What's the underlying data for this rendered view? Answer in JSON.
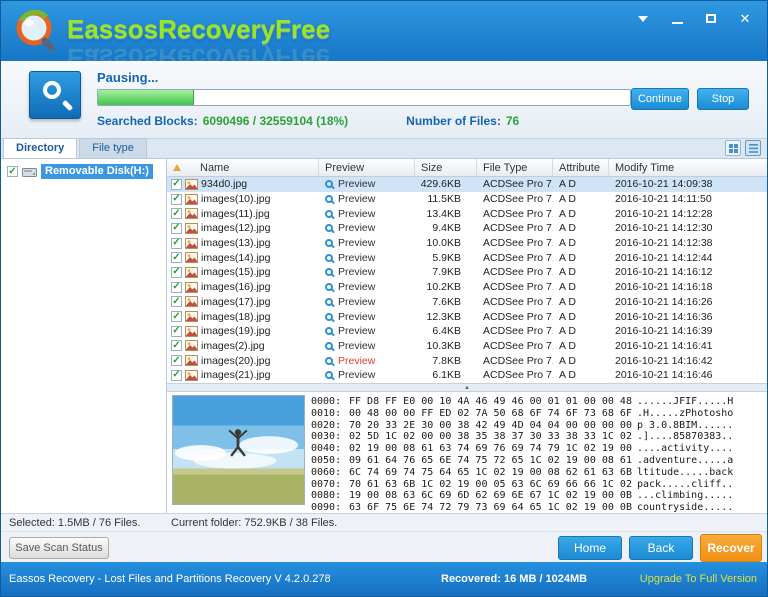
{
  "window": {
    "app_name": "Eassos Recovery Free"
  },
  "titlebar": {
    "brand_words": [
      "Eassos",
      "Recovery",
      "Free"
    ]
  },
  "progress": {
    "status": "Pausing...",
    "percent": 18,
    "continue_label": "Continue",
    "stop_label": "Stop",
    "searched_label": "Searched Blocks:",
    "searched_value": "6090496 / 32559104 (18%)",
    "files_label": "Number of Files:",
    "files_value": "76"
  },
  "tabs": [
    {
      "label": "Directory",
      "active": true
    },
    {
      "label": "File type",
      "active": false
    }
  ],
  "tree": {
    "items": [
      {
        "label": "Removable Disk(H:)",
        "checked": true,
        "selected": true
      }
    ]
  },
  "table": {
    "columns": [
      "Name",
      "Preview",
      "Size",
      "File Type",
      "Attribute",
      "Modify Time"
    ],
    "preview_label": "Preview",
    "rows": [
      {
        "name": "934d0.jpg",
        "size": "429.6KB",
        "type": "ACDSee Pro 7...",
        "attr": "A D",
        "modify_time": "2016-10-21 14:09:38",
        "checked": true,
        "selected": true
      },
      {
        "name": "images(10).jpg",
        "size": "11.5KB",
        "type": "ACDSee Pro 7...",
        "attr": "A D",
        "modify_time": "2016-10-21 14:11:50",
        "checked": true
      },
      {
        "name": "images(11).jpg",
        "size": "13.4KB",
        "type": "ACDSee Pro 7...",
        "attr": "A D",
        "modify_time": "2016-10-21 14:12:28",
        "checked": true
      },
      {
        "name": "images(12).jpg",
        "size": "9.4KB",
        "type": "ACDSee Pro 7...",
        "attr": "A D",
        "modify_time": "2016-10-21 14:12:30",
        "checked": true
      },
      {
        "name": "images(13).jpg",
        "size": "10.0KB",
        "type": "ACDSee Pro 7...",
        "attr": "A D",
        "modify_time": "2016-10-21 14:12:38",
        "checked": true
      },
      {
        "name": "images(14).jpg",
        "size": "5.9KB",
        "type": "ACDSee Pro 7...",
        "attr": "A D",
        "modify_time": "2016-10-21 14:12:44",
        "checked": true
      },
      {
        "name": "images(15).jpg",
        "size": "7.9KB",
        "type": "ACDSee Pro 7...",
        "attr": "A D",
        "modify_time": "2016-10-21 14:16:12",
        "checked": true
      },
      {
        "name": "images(16).jpg",
        "size": "10.2KB",
        "type": "ACDSee Pro 7...",
        "attr": "A D",
        "modify_time": "2016-10-21 14:16:18",
        "checked": true
      },
      {
        "name": "images(17).jpg",
        "size": "7.6KB",
        "type": "ACDSee Pro 7...",
        "attr": "A D",
        "modify_time": "2016-10-21 14:16:26",
        "checked": true
      },
      {
        "name": "images(18).jpg",
        "size": "12.3KB",
        "type": "ACDSee Pro 7...",
        "attr": "A D",
        "modify_time": "2016-10-21 14:16:36",
        "checked": true
      },
      {
        "name": "images(19).jpg",
        "size": "6.4KB",
        "type": "ACDSee Pro 7...",
        "attr": "A D",
        "modify_time": "2016-10-21 14:16:39",
        "checked": true
      },
      {
        "name": "images(2).jpg",
        "size": "10.3KB",
        "type": "ACDSee Pro 7...",
        "attr": "A D",
        "modify_time": "2016-10-21 14:16:41",
        "checked": true
      },
      {
        "name": "images(20).jpg",
        "size": "7.8KB",
        "type": "ACDSee Pro 7...",
        "attr": "A D",
        "modify_time": "2016-10-21 14:16:42",
        "checked": true,
        "preview_red": true
      },
      {
        "name": "images(21).jpg",
        "size": "6.1KB",
        "type": "ACDSee Pro 7...",
        "attr": "A D",
        "modify_time": "2016-10-21 14:16:46",
        "checked": true
      }
    ]
  },
  "preview": {
    "hex_rows": [
      {
        "offset": "0000:",
        "hex": "FF D8 FF E0 00 10 4A 46 49 46 00 01 01 00 00 48",
        "ascii": "......JFIF.....H"
      },
      {
        "offset": "0010:",
        "hex": "00 48 00 00 FF ED 02 7A 50 68 6F 74 6F 73 68 6F",
        "ascii": ".H.....zPhotosho"
      },
      {
        "offset": "0020:",
        "hex": "70 20 33 2E 30 00 38 42 49 4D 04 04 00 00 00 00",
        "ascii": "p 3.0.8BIM......"
      },
      {
        "offset": "0030:",
        "hex": "02 5D 1C 02 00 00 38 35 38 37 30 33 38 33 1C 02",
        "ascii": ".]....85870383.."
      },
      {
        "offset": "0040:",
        "hex": "02 19 00 08 61 63 74 69 76 69 74 79 1C 02 19 00",
        "ascii": "....activity...."
      },
      {
        "offset": "0050:",
        "hex": "09 61 64 76 65 6E 74 75 72 65 1C 02 19 00 08 61",
        "ascii": ".adventure.....a"
      },
      {
        "offset": "0060:",
        "hex": "6C 74 69 74 75 64 65 1C 02 19 00 08 62 61 63 6B",
        "ascii": "ltitude.....back"
      },
      {
        "offset": "0070:",
        "hex": "70 61 63 6B 1C 02 19 00 05 63 6C 69 66 66 1C 02",
        "ascii": "pack.....cliff.."
      },
      {
        "offset": "0080:",
        "hex": "19 00 08 63 6C 69 6D 62 69 6E 67 1C 02 19 00 0B",
        "ascii": "...climbing....."
      },
      {
        "offset": "0090:",
        "hex": "63 6F 75 6E 74 72 79 73 69 64 65 1C 02 19 00 0B",
        "ascii": "countryside....."
      }
    ]
  },
  "status": {
    "selected": "Selected: 1.5MB / 76 Files.",
    "current_folder": "Current folder: 752.9KB / 38 Files."
  },
  "actions": {
    "save_scan": "Save Scan Status",
    "home": "Home",
    "back": "Back",
    "recover": "Recover"
  },
  "footer": {
    "left": "Eassos Recovery - Lost Files and Partitions Recovery  V 4.2.0.278",
    "recovered_label": "Recovered:",
    "recovered_value": "16 MB / 1024MB",
    "upgrade": "Upgrade To Full Version"
  },
  "icons": {
    "logo-icon": "colorful-magnifier-logo",
    "window-menu-icon": "dropdown-triangle",
    "minimize-icon": "minimize",
    "maximize-icon": "maximize",
    "close-icon": "close",
    "search-icon": "magnifier-badge",
    "checkbox-checked-icon": "green-check",
    "image-file-icon": "picture-file",
    "magnifier-icon": "preview-magnifier",
    "disk-icon": "removable-disk",
    "sort-ascending-icon": "sort-arrow",
    "thumbnail-view-icon": "grid-view",
    "list-view-icon": "detail-view",
    "collapse-up-icon": "collapse-panel"
  },
  "colors": {
    "brand_green": "#9ce61f",
    "label_blue": "#1464b4",
    "value_green": "#2fa139",
    "progress_green": "#44c44c",
    "accent_blue": "#2196dd",
    "tree_selection": "#3b97e4",
    "selected_row": "#cfe4f7",
    "preview_red": "#e03c31",
    "recover_orange": "#ef8f12",
    "upgrade_yellow": "#d6e34b",
    "titlebar_blue": "#1d83d6"
  }
}
